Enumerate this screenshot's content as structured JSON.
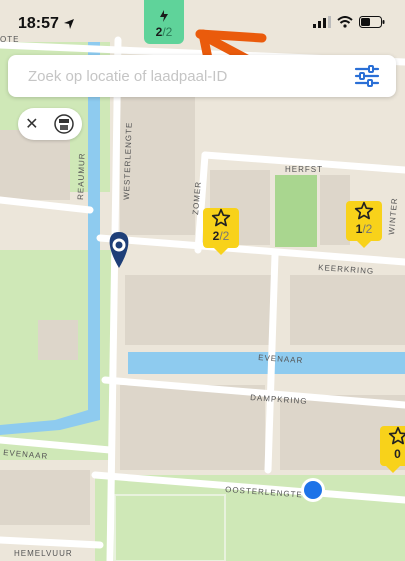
{
  "status_bar": {
    "time": "18:57"
  },
  "search": {
    "placeholder": "Zoek op locatie of laadpaal-ID"
  },
  "streets": {
    "zomer": "ZOMER",
    "herfst": "HERFST",
    "winter": "WINTER",
    "keerkring": "KEERKRING",
    "evenaar_main": "EVENAAR",
    "evenaar_left": "EVENAAR",
    "dampkring": "DAMPKRING",
    "oosterlengte": "OOSTERLENGTE",
    "hemelvuur": "HEMELVUUR",
    "westerlengte": "WESTERLENGTE",
    "reaumur": "REAUMUR",
    "ote": "OTE"
  },
  "chargers": [
    {
      "available": "2",
      "total": "2"
    },
    {
      "available": "1",
      "total": "2"
    },
    {
      "available": "0",
      "total": ""
    }
  ],
  "top_charger": {
    "available": "2",
    "total": "2"
  },
  "colors": {
    "pin": "#f8d21a",
    "pin_green": "#5fd39a",
    "water": "#8ecbef",
    "park": "#cfe8b7",
    "location": "#1e73e8",
    "arrow": "#ea5b0c"
  }
}
